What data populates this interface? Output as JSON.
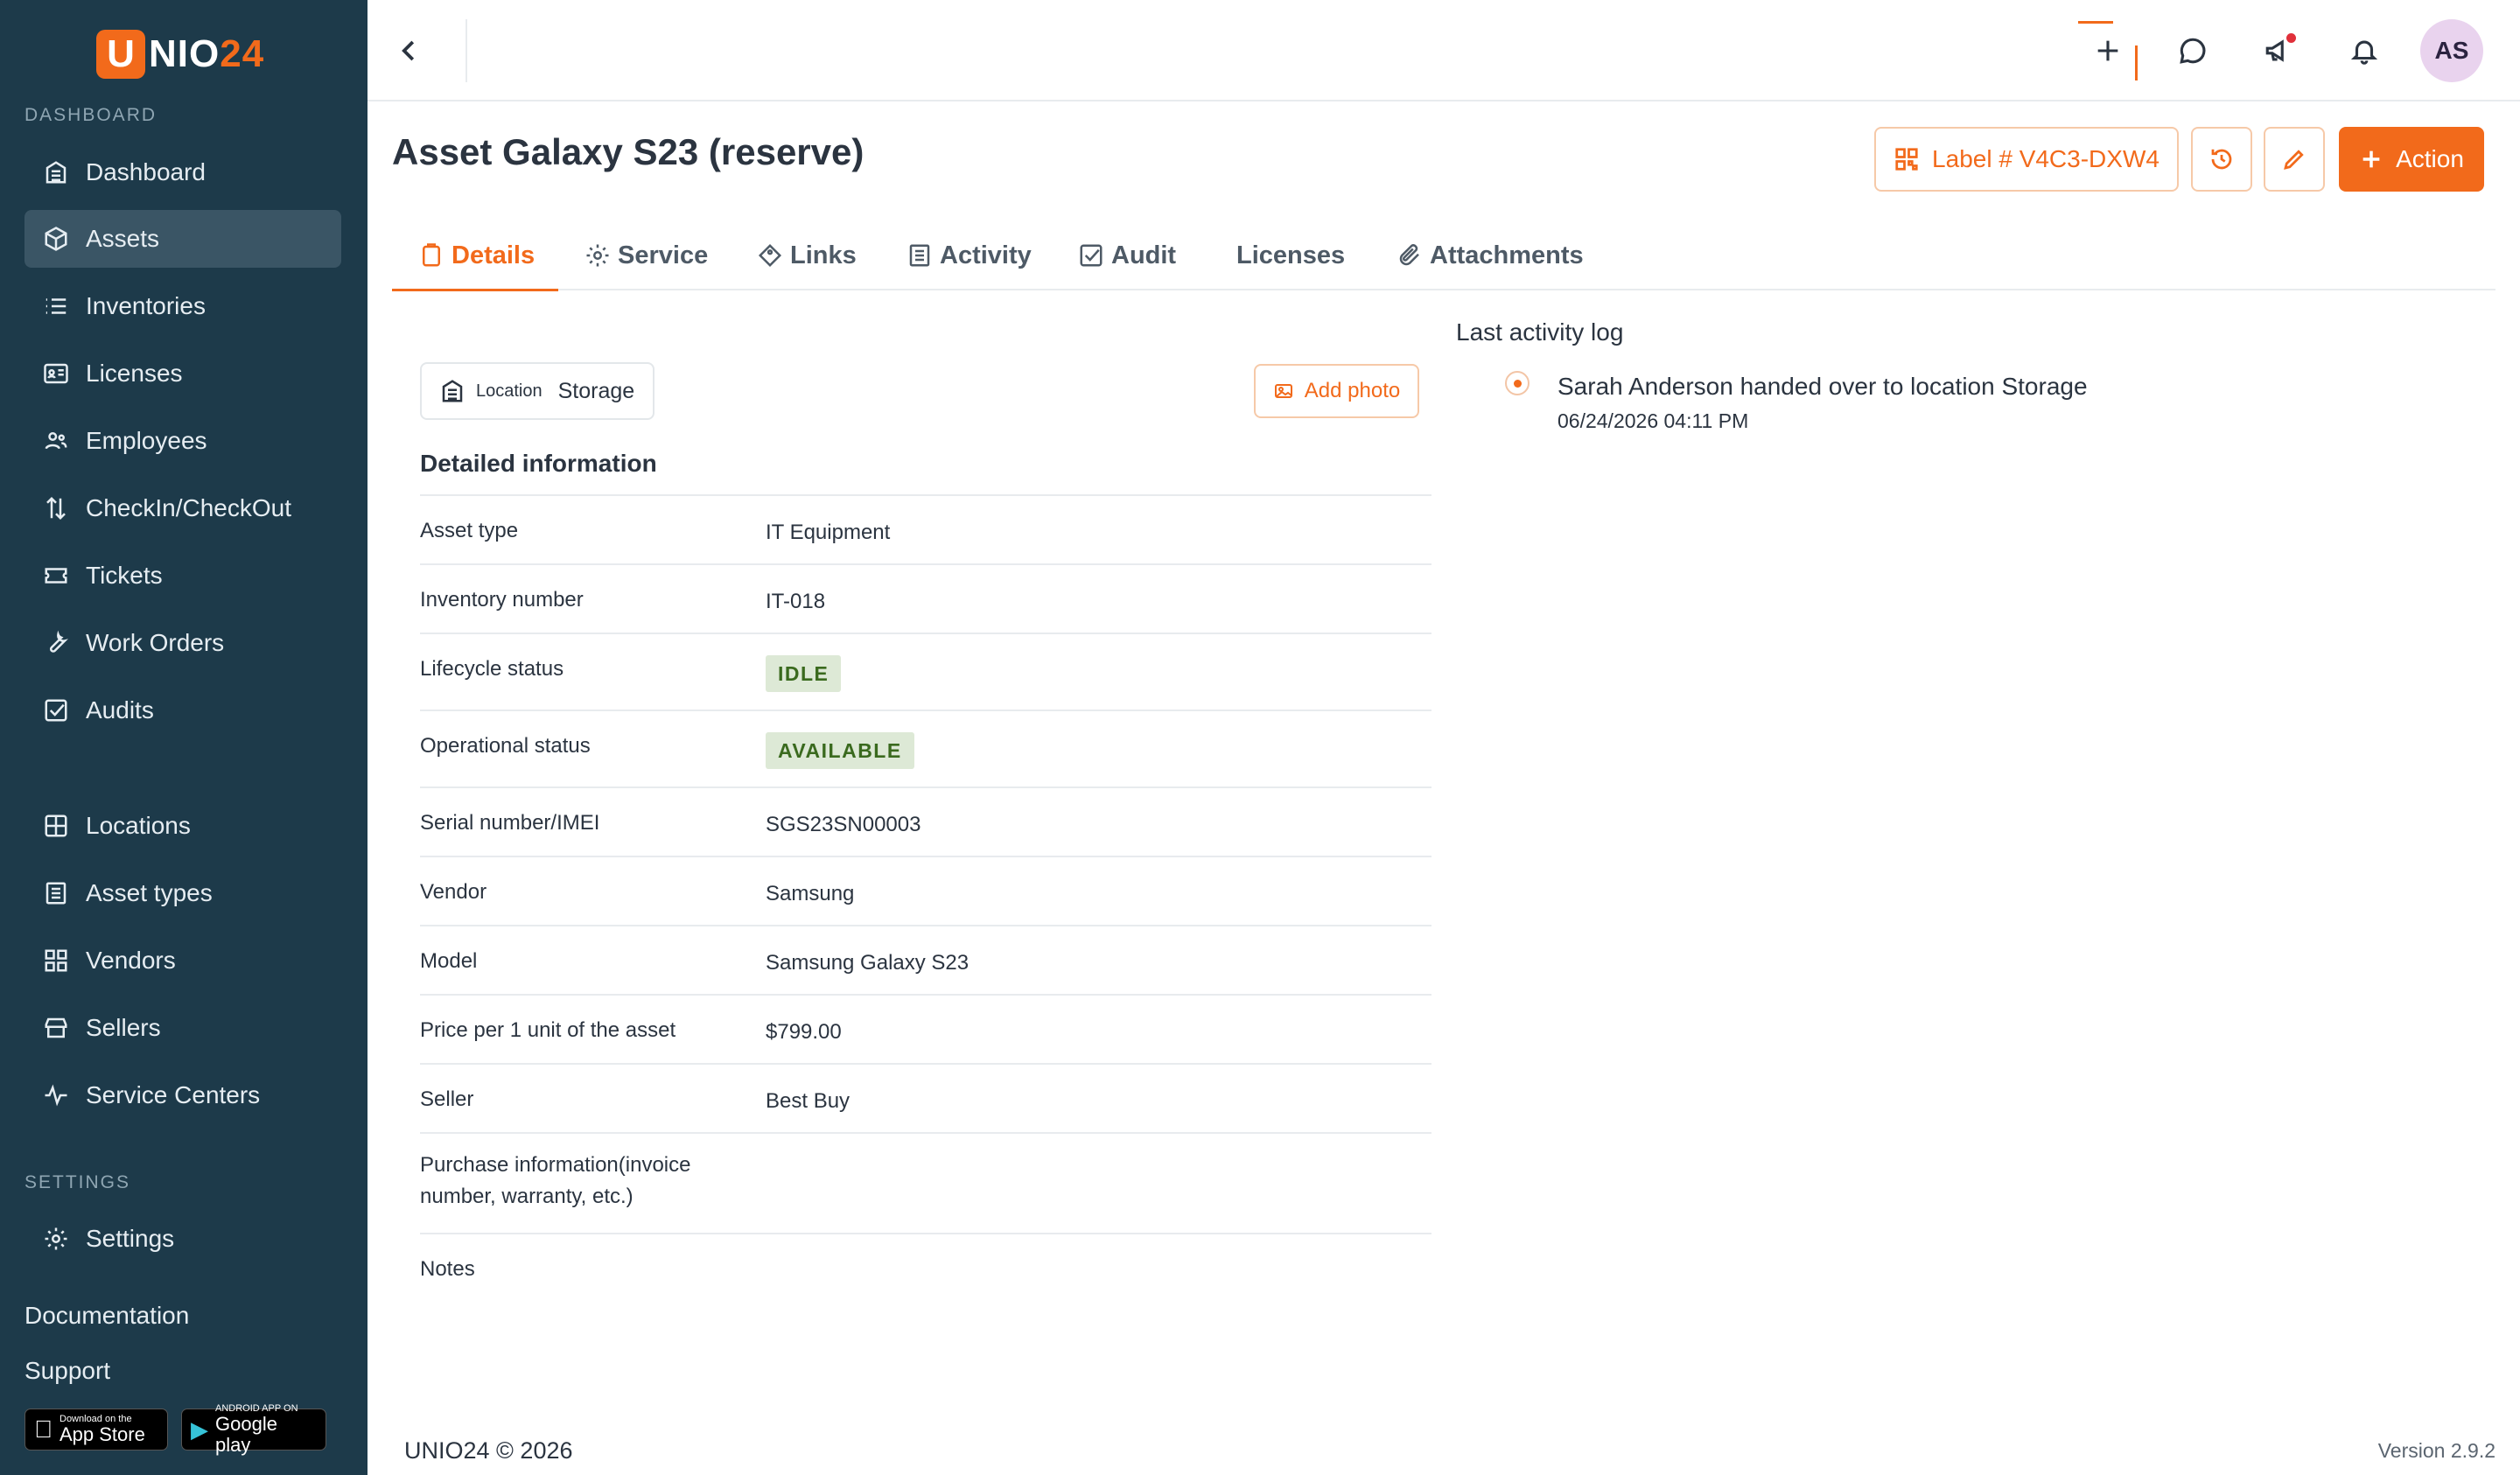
{
  "brand": {
    "logo_letter": "U",
    "logo_main": "NIO",
    "logo_accent": "24",
    "accent_color": "#f26a1b",
    "sidebar_color": "#1d3a4a"
  },
  "sidebar": {
    "dashboard_section": "DASHBOARD",
    "items": [
      {
        "label": "Dashboard",
        "icon": "building-icon"
      },
      {
        "label": "Assets",
        "icon": "box-icon",
        "active": true
      },
      {
        "label": "Inventories",
        "icon": "list-icon"
      },
      {
        "label": "Licenses",
        "icon": "id-card-icon"
      },
      {
        "label": "Employees",
        "icon": "users-icon"
      },
      {
        "label": "CheckIn/CheckOut",
        "icon": "arrows-updown-icon"
      },
      {
        "label": "Tickets",
        "icon": "ticket-icon"
      },
      {
        "label": "Work Orders",
        "icon": "wrench-icon"
      },
      {
        "label": "Audits",
        "icon": "checkbox-icon"
      }
    ],
    "items2": [
      {
        "label": "Locations",
        "icon": "grid-icon"
      },
      {
        "label": "Asset types",
        "icon": "document-icon"
      },
      {
        "label": "Vendors",
        "icon": "apps-icon"
      },
      {
        "label": "Sellers",
        "icon": "store-icon"
      },
      {
        "label": "Service Centers",
        "icon": "pulse-icon"
      }
    ],
    "settings_section": "SETTINGS",
    "settings_item": {
      "label": "Settings",
      "icon": "gear-icon"
    },
    "documentation": "Documentation",
    "support": "Support",
    "app_store": {
      "small": "Download on the",
      "big": "App Store"
    },
    "google_play": {
      "small": "ANDROID APP ON",
      "big": "Google play"
    }
  },
  "header": {
    "title": "Asset Galaxy S23 (reserve)",
    "label_button": "Label # V4C3-DXW4",
    "action_button": "Action",
    "avatar_initials": "AS"
  },
  "tabs": [
    {
      "label": "Details",
      "icon": "clipboard-icon",
      "active": true
    },
    {
      "label": "Service",
      "icon": "gear-icon"
    },
    {
      "label": "Links",
      "icon": "diamond-icon"
    },
    {
      "label": "Activity",
      "icon": "document-icon"
    },
    {
      "label": "Audit",
      "icon": "checkbox-icon"
    },
    {
      "label": "Licenses",
      "icon": ""
    },
    {
      "label": "Attachments",
      "icon": "paperclip-icon"
    }
  ],
  "details": {
    "location_label": "Location",
    "location_value": "Storage",
    "add_photo": "Add photo",
    "section_title": "Detailed information",
    "rows": [
      {
        "label": "Asset type",
        "value": "IT Equipment"
      },
      {
        "label": "Inventory number",
        "value": "IT-018"
      },
      {
        "label": "Lifecycle status",
        "badge": "IDLE"
      },
      {
        "label": "Operational status",
        "badge": "AVAILABLE"
      },
      {
        "label": "Serial number/IMEI",
        "value": "SGS23SN00003"
      },
      {
        "label": "Vendor",
        "value": "Samsung"
      },
      {
        "label": "Model",
        "value": "Samsung Galaxy S23"
      },
      {
        "label": "Price per 1 unit of the asset",
        "value": "$799.00"
      },
      {
        "label": "Seller",
        "value": "Best Buy"
      },
      {
        "label": "Purchase information(invoice number, warranty, etc.)",
        "value": ""
      },
      {
        "label": "Notes",
        "value": ""
      }
    ]
  },
  "activity_log": {
    "title": "Last activity log",
    "entries": [
      {
        "text": "Sarah Anderson handed over to location Storage",
        "time": "06/24/2026 04:11 PM"
      }
    ]
  },
  "footer": {
    "copyright": "UNIO24 © 2026",
    "version": "Version 2.9.2"
  }
}
